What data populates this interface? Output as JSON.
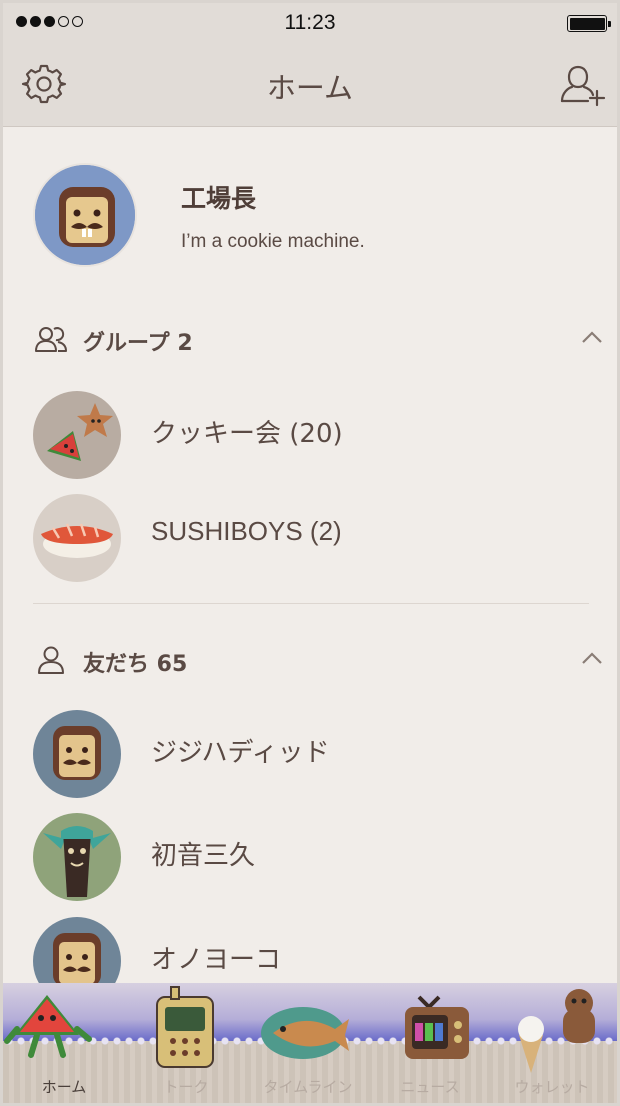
{
  "status_bar": {
    "time": "11:23",
    "signal_bars": 3,
    "signal_total": 5
  },
  "nav": {
    "title": "ホーム",
    "left_icon": "settings-gear-icon",
    "right_icon": "add-friend-icon"
  },
  "profile": {
    "name": "工場長",
    "status_message": "I’m a cookie machine."
  },
  "groups": {
    "title": "グループ 2",
    "icon": "group-icon",
    "items": [
      {
        "label": "クッキー会  (20)"
      },
      {
        "label": "SUSHIBOYS  (2)"
      }
    ]
  },
  "friends": {
    "title": "友だち 65",
    "icon": "friend-icon",
    "items": [
      {
        "label": "ジジハディッド"
      },
      {
        "label": "初音三久"
      },
      {
        "label": "オノヨーコ"
      }
    ]
  },
  "tabs": [
    {
      "label": "ホーム",
      "active": true
    },
    {
      "label": "トーク",
      "active": false
    },
    {
      "label": "タイムライン",
      "active": false
    },
    {
      "label": "ニュース",
      "active": false
    },
    {
      "label": "ウォレット",
      "active": false
    }
  ]
}
